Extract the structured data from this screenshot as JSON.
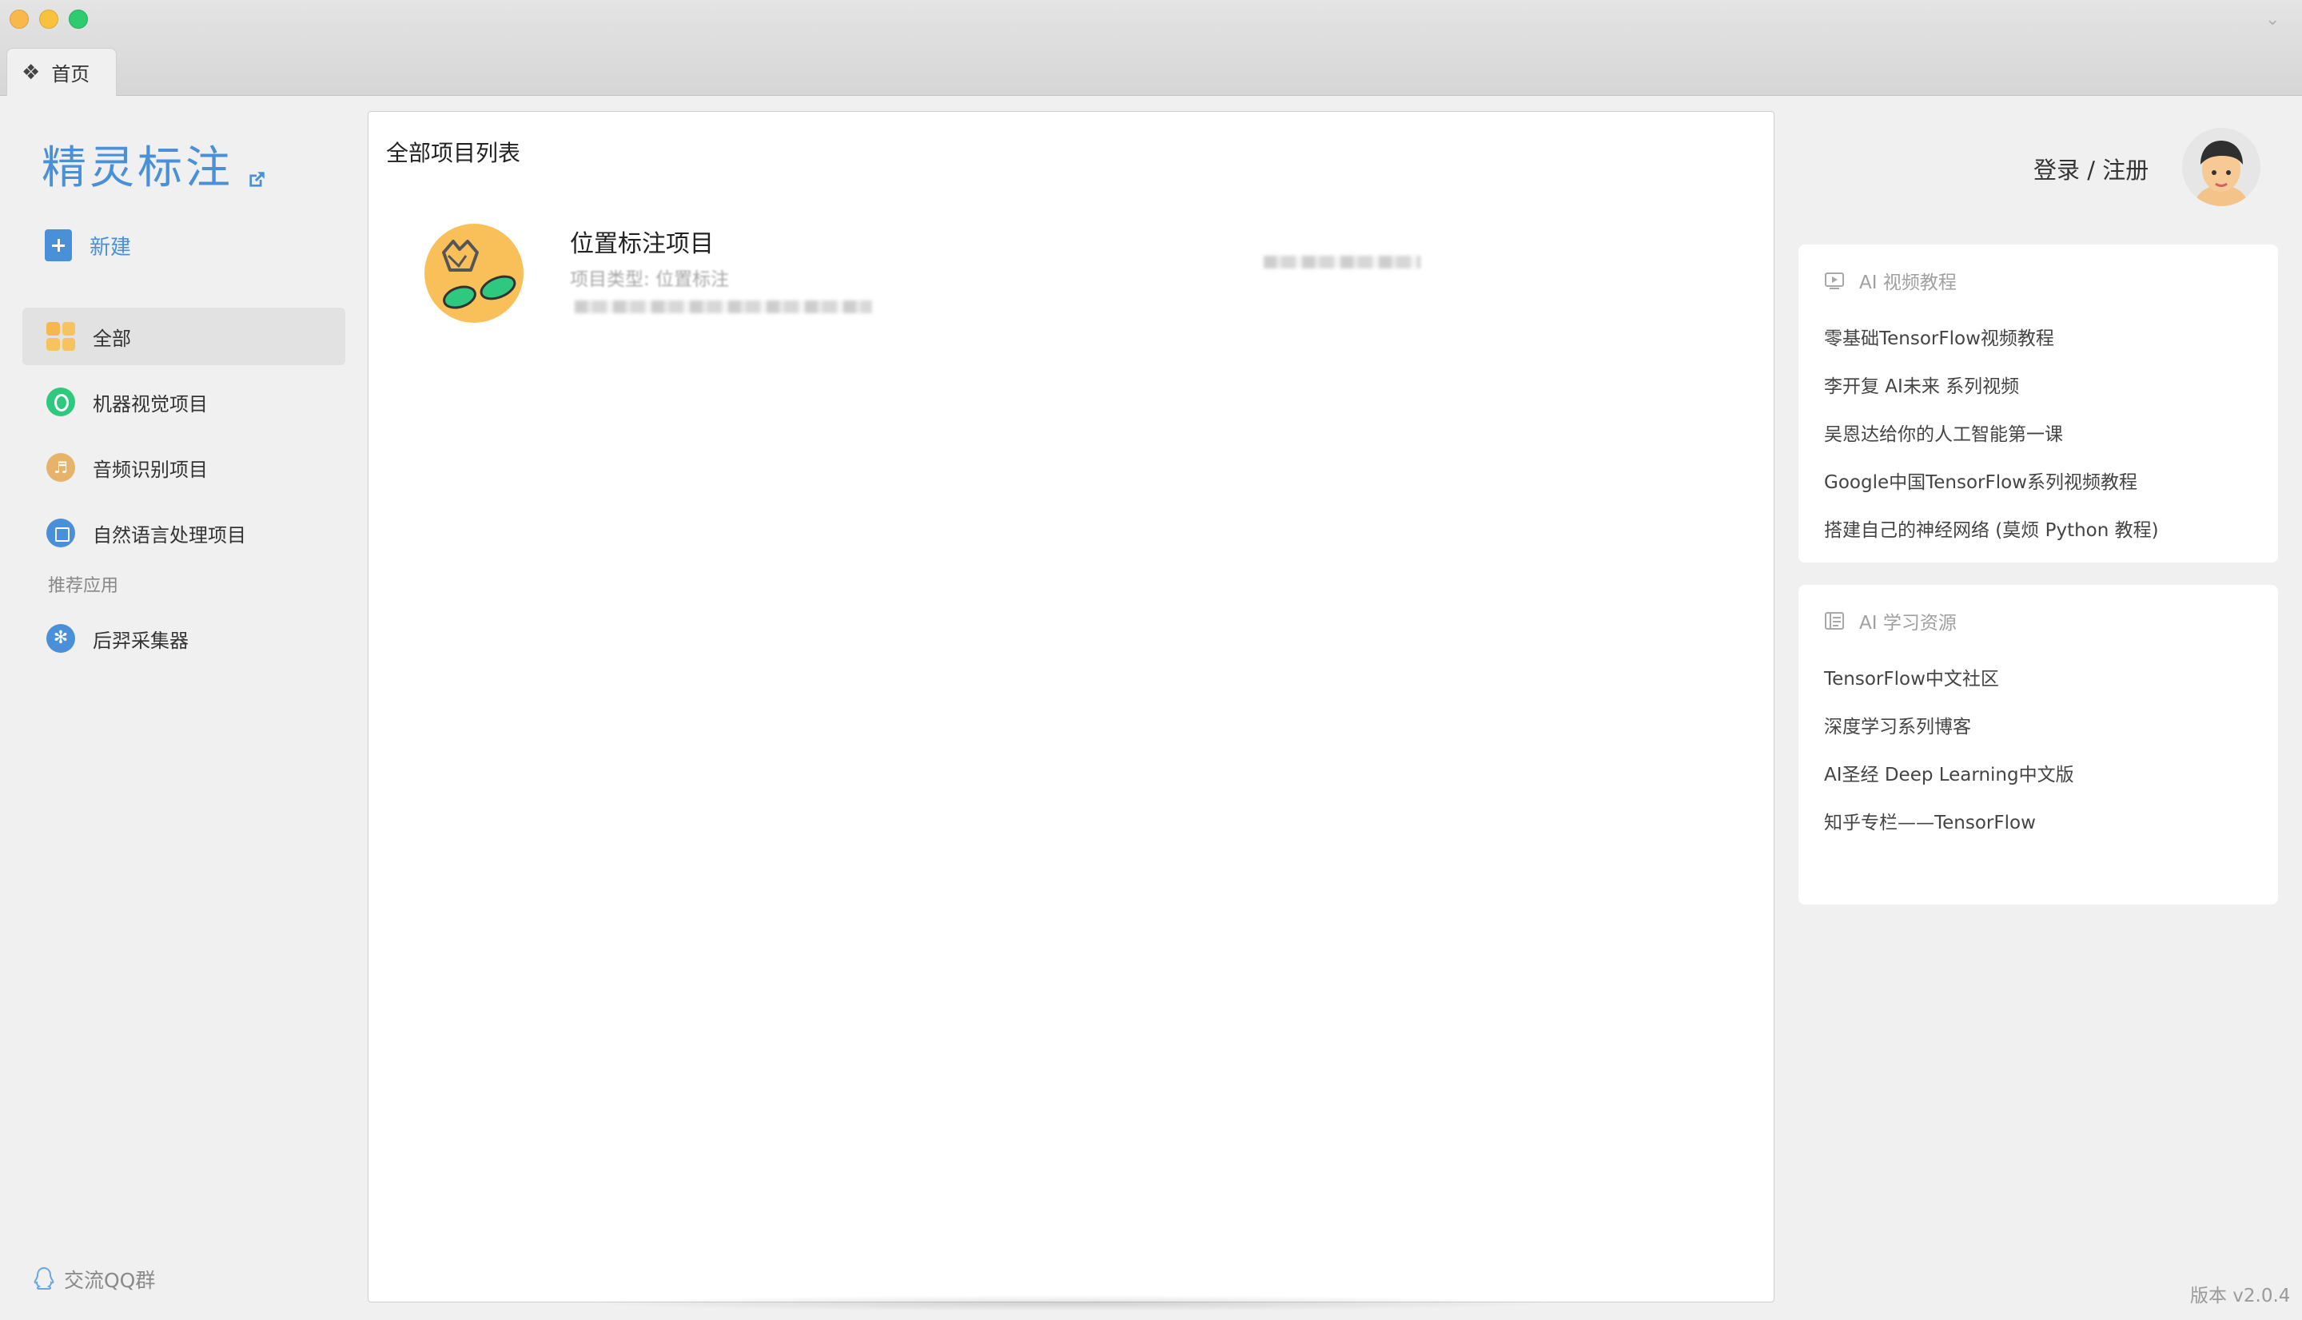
{
  "window": {
    "tab_label": "首页",
    "tab_icon": "grid-diamond-icon"
  },
  "sidebar": {
    "brand": "精灵标注",
    "new_label": "新建",
    "nav": [
      {
        "label": "全部",
        "icon": "grid-icon",
        "active": true
      },
      {
        "label": "机器视觉项目",
        "icon": "vision-icon"
      },
      {
        "label": "音频识别项目",
        "icon": "music-note-icon"
      },
      {
        "label": "自然语言处理项目",
        "icon": "document-icon"
      }
    ],
    "section_label": "推荐应用",
    "apps": [
      {
        "label": "后羿采集器",
        "icon": "houyi-icon"
      }
    ],
    "qq_label": "交流QQ群"
  },
  "main": {
    "title": "全部项目列表",
    "projects": [
      {
        "name": "位置标注项目",
        "type_label": "项目类型:",
        "type_value": "位置标注"
      }
    ]
  },
  "right": {
    "login_label": "登录 / 注册",
    "video_card": {
      "title": "AI 视频教程",
      "links": [
        "零基础TensorFlow视频教程",
        "李开复 AI未来 系列视频",
        "吴恩达给你的人工智能第一课",
        "Google中国TensorFlow系列视频教程",
        "搭建自己的神经网络 (莫烦 Python 教程)"
      ]
    },
    "resource_card": {
      "title": "AI 学习资源",
      "links": [
        "TensorFlow中文社区",
        "深度学习系列博客",
        "AI圣经 Deep Learning中文版",
        "知乎专栏——TensorFlow"
      ]
    },
    "version": "版本 v2.0.4"
  },
  "colors": {
    "accent": "#4a90d9",
    "vision": "#2ec97e",
    "audio": "#e6b36a",
    "project_avatar": "#f9c05a"
  }
}
